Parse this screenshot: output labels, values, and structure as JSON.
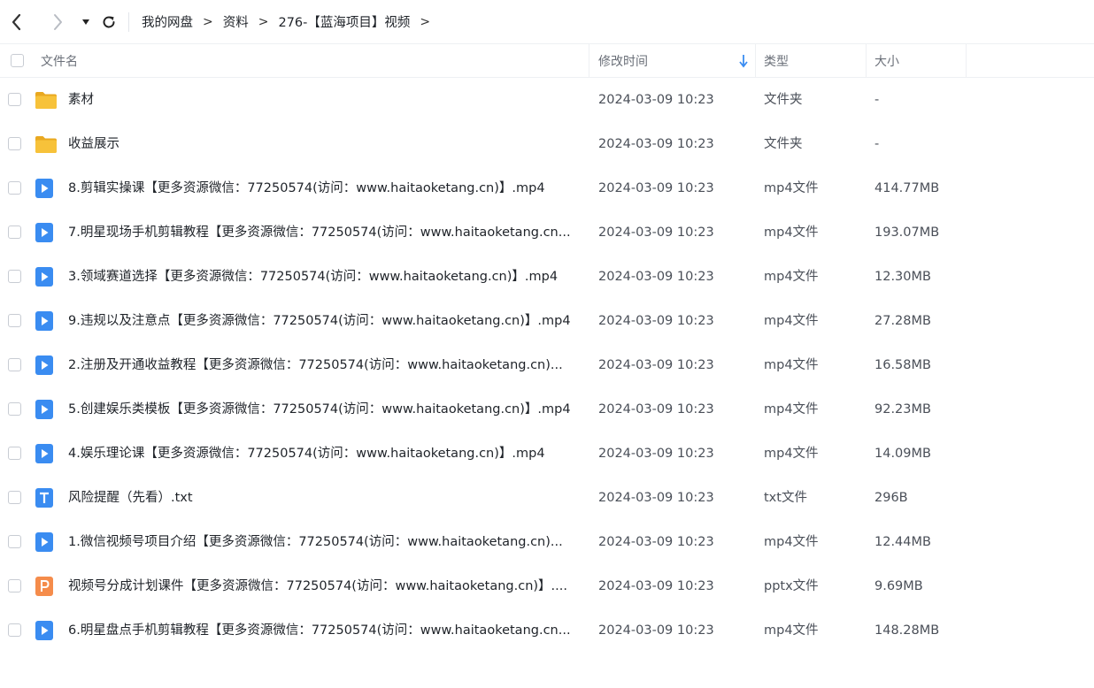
{
  "breadcrumb": [
    "我的网盘",
    "资料",
    "276-【蓝海项目】视频"
  ],
  "columns": {
    "name": "文件名",
    "time": "修改时间",
    "type": "类型",
    "size": "大小"
  },
  "colors": {
    "folder": "#f7c23a",
    "video": "#3a8cf1",
    "txt": "#3a8cf1",
    "ppt": "#f58c4b"
  },
  "files": [
    {
      "icon": "folder-icon",
      "name": "素材",
      "time": "2024-03-09 10:23",
      "type": "文件夹",
      "size": "-"
    },
    {
      "icon": "folder-icon",
      "name": "收益展示",
      "time": "2024-03-09 10:23",
      "type": "文件夹",
      "size": "-"
    },
    {
      "icon": "video-file-icon",
      "name": "8.剪辑实操课【更多资源微信：77250574(访问：www.haitaoketang.cn)】.mp4",
      "time": "2024-03-09 10:23",
      "type": "mp4文件",
      "size": "414.77MB"
    },
    {
      "icon": "video-file-icon",
      "name": "7.明星现场手机剪辑教程【更多资源微信：77250574(访问：www.haitaoketang.cn...",
      "time": "2024-03-09 10:23",
      "type": "mp4文件",
      "size": "193.07MB"
    },
    {
      "icon": "video-file-icon",
      "name": "3.领域赛道选择【更多资源微信：77250574(访问：www.haitaoketang.cn)】.mp4",
      "time": "2024-03-09 10:23",
      "type": "mp4文件",
      "size": "12.30MB"
    },
    {
      "icon": "video-file-icon",
      "name": "9.违规以及注意点【更多资源微信：77250574(访问：www.haitaoketang.cn)】.mp4",
      "time": "2024-03-09 10:23",
      "type": "mp4文件",
      "size": "27.28MB"
    },
    {
      "icon": "video-file-icon",
      "name": "2.注册及开通收益教程【更多资源微信：77250574(访问：www.haitaoketang.cn)...",
      "time": "2024-03-09 10:23",
      "type": "mp4文件",
      "size": "16.58MB"
    },
    {
      "icon": "video-file-icon",
      "name": "5.创建娱乐类模板【更多资源微信：77250574(访问：www.haitaoketang.cn)】.mp4",
      "time": "2024-03-09 10:23",
      "type": "mp4文件",
      "size": "92.23MB"
    },
    {
      "icon": "video-file-icon",
      "name": "4.娱乐理论课【更多资源微信：77250574(访问：www.haitaoketang.cn)】.mp4",
      "time": "2024-03-09 10:23",
      "type": "mp4文件",
      "size": "14.09MB"
    },
    {
      "icon": "text-file-icon",
      "name": "风险提醒（先看）.txt",
      "time": "2024-03-09 10:23",
      "type": "txt文件",
      "size": "296B"
    },
    {
      "icon": "video-file-icon",
      "name": "1.微信视频号项目介绍【更多资源微信：77250574(访问：www.haitaoketang.cn)...",
      "time": "2024-03-09 10:23",
      "type": "mp4文件",
      "size": "12.44MB"
    },
    {
      "icon": "ppt-file-icon",
      "name": "视频号分成计划课件【更多资源微信：77250574(访问：www.haitaoketang.cn)】....",
      "time": "2024-03-09 10:23",
      "type": "pptx文件",
      "size": "9.69MB"
    },
    {
      "icon": "video-file-icon",
      "name": "6.明星盘点手机剪辑教程【更多资源微信：77250574(访问：www.haitaoketang.cn...",
      "time": "2024-03-09 10:23",
      "type": "mp4文件",
      "size": "148.28MB"
    }
  ]
}
